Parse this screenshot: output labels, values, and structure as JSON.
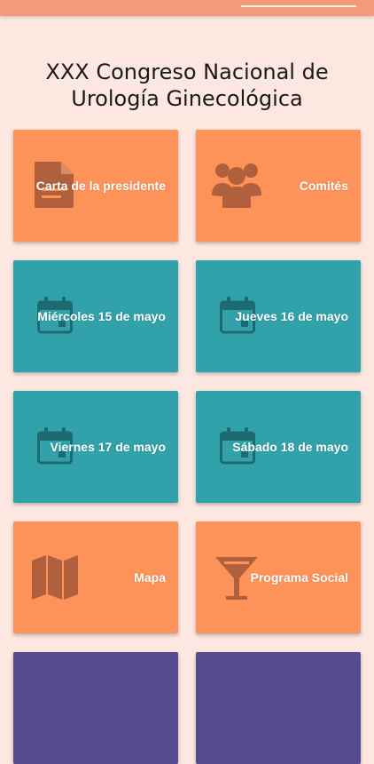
{
  "header": {
    "title_line1": "XXX Congreso Nacional de",
    "title_line2": "Urología Ginecológica"
  },
  "colors": {
    "background": "#fde8e1",
    "orange": "#fd9359",
    "teal": "#31a1aa",
    "purple": "#574a8e",
    "icon_orange": "#b0603c",
    "icon_teal": "#1e6a72"
  },
  "tiles": [
    {
      "label": "Carta de la presidente",
      "icon": "document-icon"
    },
    {
      "label": "Comités",
      "icon": "group-icon"
    },
    {
      "label": "Miércoles 15 de mayo",
      "icon": "calendar-icon"
    },
    {
      "label": "Jueves 16 de mayo",
      "icon": "calendar-icon"
    },
    {
      "label": "Viernes 17 de mayo",
      "icon": "calendar-icon"
    },
    {
      "label": "Sábado 18 de mayo",
      "icon": "calendar-icon"
    },
    {
      "label": "Mapa",
      "icon": "map-icon"
    },
    {
      "label": "Programa Social",
      "icon": "cocktail-icon"
    }
  ]
}
